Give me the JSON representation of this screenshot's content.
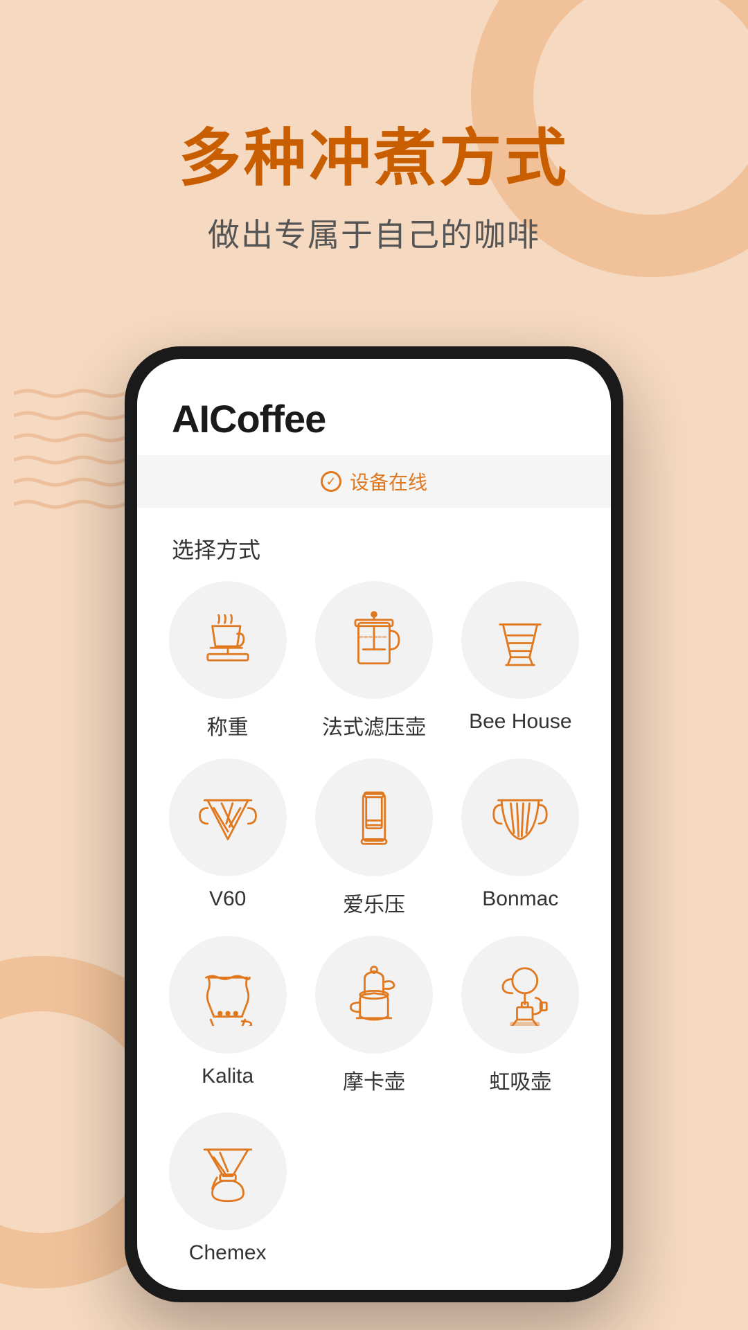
{
  "background": {
    "color": "#f5d9c0",
    "accent_color": "#f0b88a"
  },
  "hero": {
    "title": "多种冲煮方式",
    "subtitle": "做出专属于自己的咖啡"
  },
  "app": {
    "title": "AICoffee",
    "status_label": "设备在线",
    "section_label": "选择方式"
  },
  "methods": [
    {
      "id": "scale",
      "label": "称重",
      "icon": "scale"
    },
    {
      "id": "french-press",
      "label": "法式滤压壶",
      "icon": "french-press"
    },
    {
      "id": "bee-house",
      "label": "Bee House",
      "icon": "bee-house"
    },
    {
      "id": "v60",
      "label": "V60",
      "icon": "v60"
    },
    {
      "id": "aeropress",
      "label": "爱乐压",
      "icon": "aeropress"
    },
    {
      "id": "bonmac",
      "label": "Bonmac",
      "icon": "bonmac"
    },
    {
      "id": "kalita",
      "label": "Kalita",
      "icon": "kalita"
    },
    {
      "id": "moka",
      "label": "摩卡壶",
      "icon": "moka"
    },
    {
      "id": "siphon",
      "label": "虹吸壶",
      "icon": "siphon"
    },
    {
      "id": "chemex",
      "label": "Chemex",
      "icon": "chemex"
    }
  ],
  "colors": {
    "orange": "#e07820",
    "text_dark": "#1a1a1a",
    "text_medium": "#555",
    "bg_light": "#f2f2f2"
  }
}
